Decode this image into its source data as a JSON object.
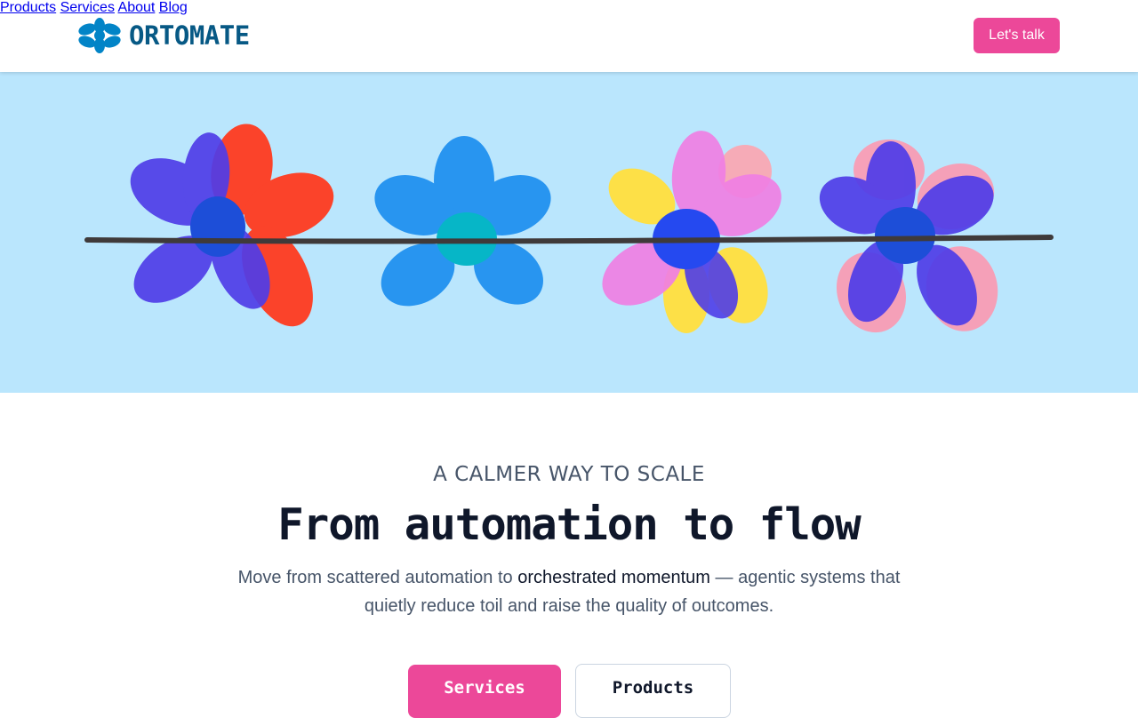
{
  "header": {
    "logo_text": "ORTOMATE",
    "logo_icon": "flower-logo-icon",
    "nav": [
      {
        "label": "Products"
      },
      {
        "label": "Services"
      },
      {
        "label": "About"
      },
      {
        "label": "Blog"
      }
    ],
    "cta_label": "Let's talk"
  },
  "hero": {
    "illustration": "four hand-drawn flowers on a stem",
    "background_color": "#bae6fd"
  },
  "content": {
    "eyebrow": "A CALMER WAY TO SCALE",
    "headline": "From automation to flow",
    "subtext_part1": "Move from scattered automation to ",
    "subtext_emphasis": "orchestrated momentum",
    "subtext_part2": " — agentic systems that quietly reduce toil and raise the quality of outcomes."
  },
  "buttons": {
    "primary_label": "Services",
    "secondary_label": "Products"
  },
  "colors": {
    "accent": "#ec4899",
    "brand": "#075985",
    "hero_bg": "#bae6fd"
  }
}
